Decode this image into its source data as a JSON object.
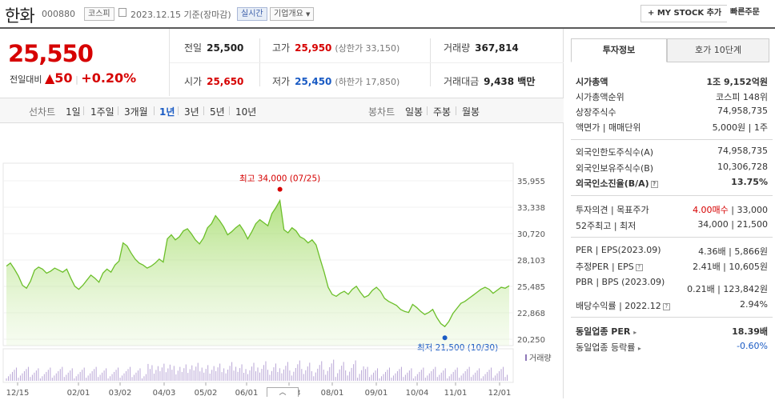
{
  "header": {
    "name": "한화",
    "code": "000880",
    "market_tag": "코스피",
    "date": "2023.12.15 기준(장마감)",
    "realtime_tag": "실시간",
    "overview_tag": "기업개요",
    "mystock_label": "+ MY STOCK 추가",
    "quick_order_label": "빠른주문"
  },
  "price": {
    "current": "25,550",
    "prev_label": "전일대비",
    "change": "50",
    "change_pct": "+0.20%"
  },
  "stats": {
    "prev_close_label": "전일",
    "prev_close": "25,500",
    "high_label": "고가",
    "high": "25,950",
    "upper_limit": "(상한가 33,150)",
    "volume_label": "거래량",
    "volume": "367,814",
    "open_label": "시가",
    "open": "25,650",
    "low_label": "저가",
    "low": "25,450",
    "lower_limit": "(하한가 17,850)",
    "amount_label": "거래대금",
    "amount": "9,438 백만"
  },
  "period": {
    "line_label": "선차트",
    "options": [
      "1일",
      "1주일",
      "3개월",
      "1년",
      "3년",
      "5년",
      "10년"
    ],
    "active": "1년",
    "candle_label": "봉차트",
    "candle_options": [
      "일봉",
      "주봉",
      "월봉"
    ]
  },
  "chart_data": {
    "type": "area",
    "y_ticks": [
      "35,955",
      "33,338",
      "30,720",
      "28,103",
      "25,485",
      "22,868",
      "20,250"
    ],
    "ylim": [
      20250,
      35955
    ],
    "x_ticks": [
      "12/15",
      "02/01",
      "03/02",
      "04/03",
      "05/02",
      "06/01",
      "07/03",
      "08/01",
      "09/01",
      "10/04",
      "11/01",
      "12/01"
    ],
    "high_annotation": "최고 34,000 (07/25)",
    "low_annotation": "최저 21,500 (10/30)",
    "volume_label": "거래량",
    "values": [
      27500,
      27800,
      27200,
      26500,
      25600,
      25300,
      26000,
      27100,
      27400,
      27200,
      26800,
      27000,
      27300,
      27100,
      26900,
      27200,
      26300,
      25500,
      25200,
      25600,
      26100,
      26600,
      26300,
      25900,
      26800,
      27200,
      26900,
      27600,
      28000,
      29800,
      29500,
      28800,
      28200,
      27800,
      27600,
      27300,
      27500,
      27800,
      28200,
      27900,
      30200,
      30600,
      30100,
      30400,
      31000,
      31200,
      30700,
      30100,
      29700,
      30300,
      31300,
      31700,
      32500,
      32000,
      31400,
      30600,
      30900,
      31300,
      31600,
      31000,
      30200,
      30900,
      31700,
      32100,
      31800,
      31500,
      32700,
      33300,
      34000,
      31100,
      30800,
      31300,
      31000,
      30400,
      30200,
      29800,
      30100,
      29600,
      28200,
      26900,
      25400,
      24700,
      24500,
      24800,
      25000,
      24700,
      25200,
      25500,
      24900,
      24400,
      24600,
      25100,
      25400,
      25000,
      24300,
      24000,
      23800,
      23600,
      23200,
      23000,
      22900,
      23700,
      23400,
      23000,
      22700,
      22900,
      23200,
      22400,
      21800,
      21500,
      22000,
      22800,
      23300,
      23800,
      24000,
      24300,
      24600,
      24900,
      25200,
      25400,
      25200,
      24800,
      25100,
      25400,
      25300,
      25550
    ]
  },
  "tabs": {
    "invest": "투자정보",
    "hoga": "호가 10단계"
  },
  "invest": {
    "market_cap_label": "시가총액",
    "market_cap": "1조 9,152억원",
    "rank_label": "시가총액순위",
    "rank": "코스피 148위",
    "shares_label": "상장주식수",
    "shares": "74,958,735",
    "face_label": "액면가 | 매매단위",
    "face": "5,000원 | 1주",
    "foreign_limit_label": "외국인한도주식수(A)",
    "foreign_limit": "74,958,735",
    "foreign_hold_label": "외국인보유주식수(B)",
    "foreign_hold": "10,306,728",
    "foreign_ratio_label": "외국인소진율(B/A)",
    "foreign_ratio": "13.75%",
    "opinion_label": "투자의견 | 목표주가",
    "opinion": "4.00매수",
    "target": "| 33,000",
    "week52_label": "52주최고 | 최저",
    "week52": "34,000 | 21,500",
    "per_label": "PER | EPS(2023.09)",
    "per": "4.36배 | 5,866원",
    "est_per_label": "추정PER | EPS",
    "est_per": "2.41배 | 10,605원",
    "pbr_label": "PBR | BPS (2023.09)",
    "pbr": "0.21배 | 123,842원",
    "dividend_label": "배당수익률 | 2022.12",
    "dividend": "2.94%",
    "sector_per_label": "동일업종 PER",
    "sector_per": "18.39배",
    "sector_change_label": "동일업종 등락률",
    "sector_change": "-0.60%"
  },
  "colors": {
    "up": "#d60000",
    "down": "#1a5bc4",
    "area": "#8ed14a"
  }
}
